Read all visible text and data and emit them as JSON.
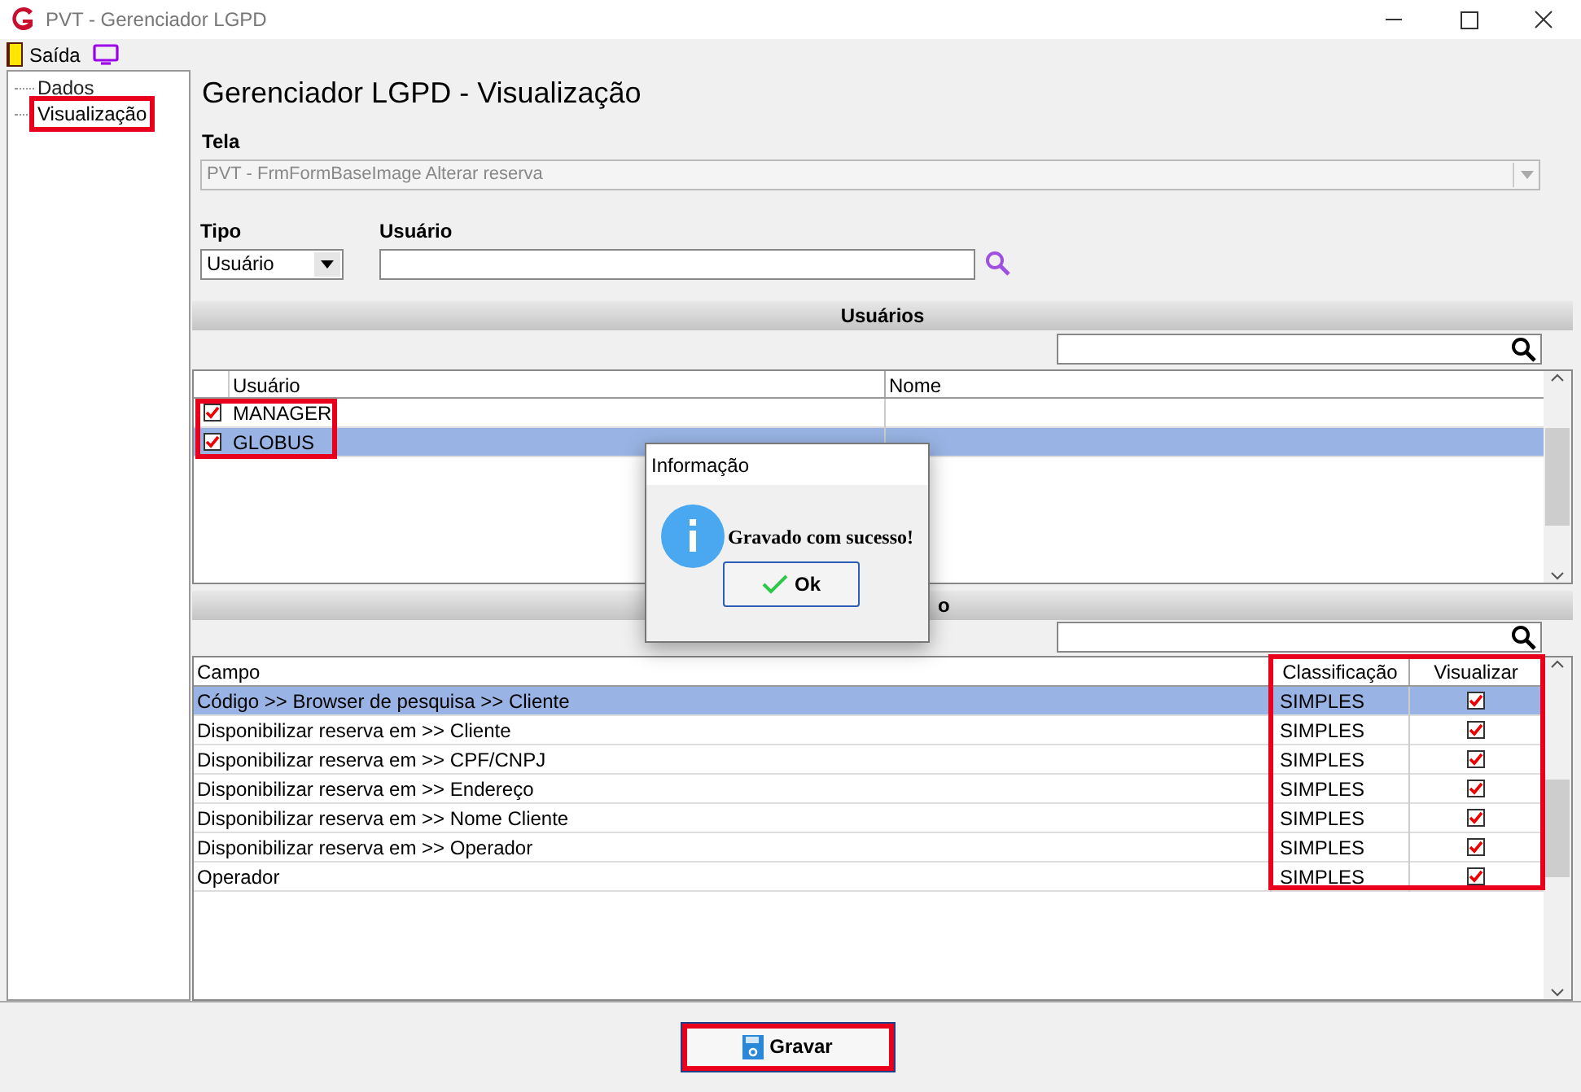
{
  "window": {
    "title": "PVT - Gerenciador LGPD"
  },
  "menu": [
    {
      "kind": "exit",
      "label": "Saída"
    },
    {
      "kind": "screen"
    }
  ],
  "tree": [
    {
      "label": "Dados",
      "selected": false,
      "highlighted": false
    },
    {
      "label": "Visualização",
      "selected": true,
      "highlighted": true
    }
  ],
  "heading": "Gerenciador LGPD - Visualização",
  "tela": {
    "label": "Tela",
    "value": "PVT - FrmFormBaseImage Alterar reserva",
    "disabled": true
  },
  "tipo": {
    "label": "Tipo",
    "value": "Usuário"
  },
  "usuario": {
    "label": "Usuário"
  },
  "users_section": {
    "title": "Usuários",
    "columns": [
      "Usuário",
      "Nome"
    ],
    "rows": [
      {
        "user": "MANAGER",
        "checked": true,
        "selected": false
      },
      {
        "user": "GLOBUS",
        "checked": true,
        "selected": true
      }
    ]
  },
  "fields_section": {
    "title": "o",
    "columns": [
      "Campo",
      "Classificação",
      "Visualizar"
    ],
    "rows": [
      {
        "campo": "Código >> Browser de pesquisa >> Cliente",
        "class": "SIMPLES",
        "checked": true,
        "selected": true
      },
      {
        "campo": "Disponibilizar reserva em >> Cliente",
        "class": "SIMPLES",
        "checked": true,
        "selected": false
      },
      {
        "campo": "Disponibilizar reserva em >> CPF/CNPJ",
        "class": "SIMPLES",
        "checked": true,
        "selected": false
      },
      {
        "campo": "Disponibilizar reserva em >> Endereço",
        "class": "SIMPLES",
        "checked": true,
        "selected": false
      },
      {
        "campo": "Disponibilizar reserva em >> Nome Cliente",
        "class": "SIMPLES",
        "checked": true,
        "selected": false
      },
      {
        "campo": "Disponibilizar reserva em >> Operador",
        "class": "SIMPLES",
        "checked": true,
        "selected": false
      },
      {
        "campo": "Operador",
        "class": "SIMPLES",
        "checked": true,
        "selected": false
      }
    ]
  },
  "save_button": {
    "label": "Gravar"
  },
  "dialog": {
    "title": "Informação",
    "message": "Gravado com sucesso!",
    "button": "Ok"
  }
}
